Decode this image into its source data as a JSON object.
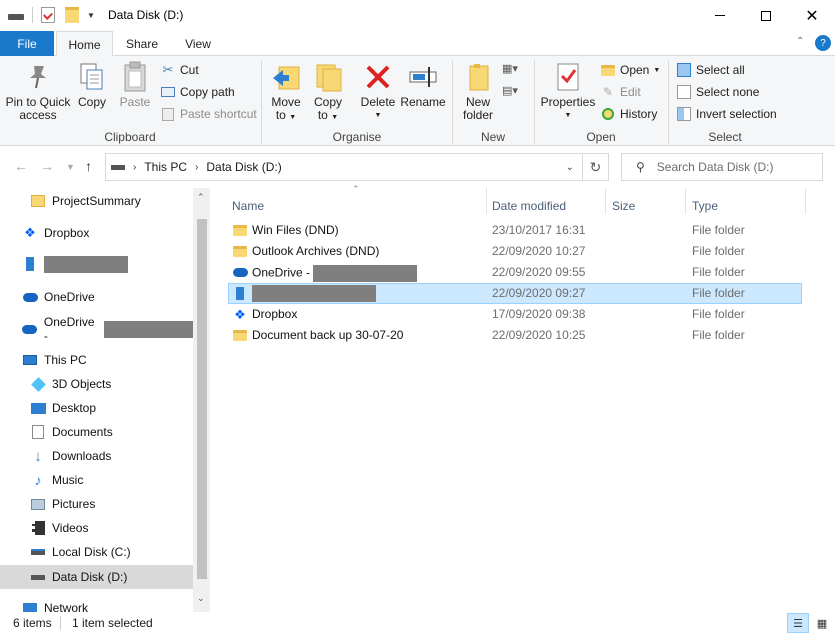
{
  "titlebar": {
    "title": "Data Disk (D:)",
    "min_icon": "minimize-icon",
    "max_icon": "maximize-icon",
    "close_icon": "close-icon"
  },
  "menubar": {
    "file": "File",
    "tabs": [
      "Home",
      "Share",
      "View"
    ]
  },
  "ribbon": {
    "clipboard": {
      "label": "Clipboard",
      "pin": "Pin to Quick",
      "pin2": "access",
      "copy": "Copy",
      "paste": "Paste",
      "cut": "Cut",
      "copy_path": "Copy path",
      "paste_shortcut": "Paste shortcut"
    },
    "organise": {
      "label": "Organise",
      "move": "Move",
      "move2": "to",
      "copy": "Copy",
      "copy2": "to",
      "delete": "Delete",
      "rename": "Rename"
    },
    "new": {
      "label": "New",
      "folder": "New",
      "folder2": "folder"
    },
    "open": {
      "label": "Open",
      "properties": "Properties",
      "open": "Open",
      "edit": "Edit",
      "history": "History"
    },
    "select": {
      "label": "Select",
      "select_all": "Select all",
      "select_none": "Select none",
      "invert": "Invert selection"
    }
  },
  "address": {
    "root": "This PC",
    "current": "Data Disk (D:)",
    "search_placeholder": "Search Data Disk (D:)"
  },
  "nav": {
    "items": [
      {
        "label": "ProjectSummary",
        "icon": "shortcut-icon"
      },
      {
        "label": "Dropbox",
        "icon": "dropbox-icon"
      },
      {
        "label": "",
        "icon": "building-icon"
      },
      {
        "label": "OneDrive",
        "icon": "onedrive-icon"
      },
      {
        "label": "OneDrive -",
        "icon": "onedrive-icon"
      },
      {
        "label": "This PC",
        "icon": "computer-icon"
      },
      {
        "label": "3D Objects",
        "icon": "3d-objects-icon"
      },
      {
        "label": "Desktop",
        "icon": "desktop-icon"
      },
      {
        "label": "Documents",
        "icon": "documents-icon"
      },
      {
        "label": "Downloads",
        "icon": "downloads-icon"
      },
      {
        "label": "Music",
        "icon": "music-icon"
      },
      {
        "label": "Pictures",
        "icon": "pictures-icon"
      },
      {
        "label": "Videos",
        "icon": "videos-icon"
      },
      {
        "label": "Local Disk (C:)",
        "icon": "drive-icon"
      },
      {
        "label": "Data Disk (D:)",
        "icon": "drive-icon"
      },
      {
        "label": "Network",
        "icon": "network-icon"
      }
    ]
  },
  "columns": {
    "name": "Name",
    "date": "Date modified",
    "size": "Size",
    "type": "Type"
  },
  "files": [
    {
      "name": "Win Files (DND)",
      "date": "23/10/2017 16:31",
      "type": "File folder",
      "icon": "folder-icon"
    },
    {
      "name": "Outlook Archives (DND)",
      "date": "22/09/2020 10:27",
      "type": "File folder",
      "icon": "folder-icon"
    },
    {
      "name": "OneDrive -",
      "date": "22/09/2020 09:55",
      "type": "File folder",
      "icon": "onedrive-icon"
    },
    {
      "name": "",
      "date": "22/09/2020 09:27",
      "type": "File folder",
      "icon": "building-icon"
    },
    {
      "name": "Dropbox",
      "date": "17/09/2020 09:38",
      "type": "File folder",
      "icon": "dropbox-icon"
    },
    {
      "name": "Document back up 30-07-20",
      "date": "22/09/2020 10:25",
      "type": "File folder",
      "icon": "folder-icon"
    }
  ],
  "status": {
    "count": "6 items",
    "selected": "1 item selected"
  },
  "colors": {
    "accent": "#1979ca",
    "selection": "#cce8ff",
    "selection_border": "#99d1ff"
  }
}
